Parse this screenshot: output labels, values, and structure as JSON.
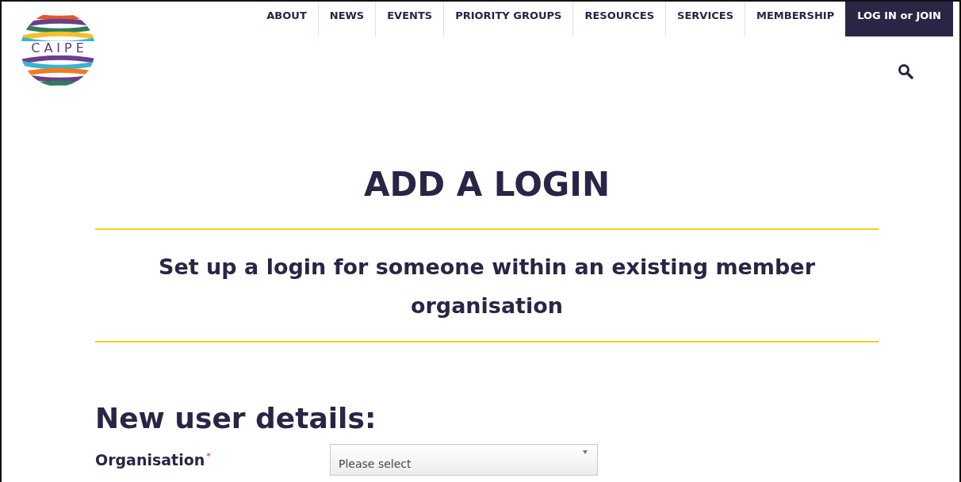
{
  "logo": {
    "text": "CAIPE"
  },
  "nav": [
    {
      "label": "ABOUT",
      "kind": "link"
    },
    {
      "label": "NEWS",
      "kind": "link"
    },
    {
      "label": "EVENTS",
      "kind": "link"
    },
    {
      "label": "PRIORITY GROUPS",
      "kind": "link"
    },
    {
      "label": "RESOURCES",
      "kind": "link"
    },
    {
      "label": "SERVICES",
      "kind": "link"
    },
    {
      "label": "MEMBERSHIP",
      "kind": "link"
    },
    {
      "label": "LOG IN or JOIN",
      "kind": "button"
    }
  ],
  "title": "ADD A LOGIN",
  "subtitle": "Set up a login for someone within an existing member organisation",
  "section_heading": "New user details:",
  "fields": [
    {
      "label": "Organisation",
      "required_mark": "*",
      "placeholder": "Please select",
      "kind": "select"
    }
  ]
}
